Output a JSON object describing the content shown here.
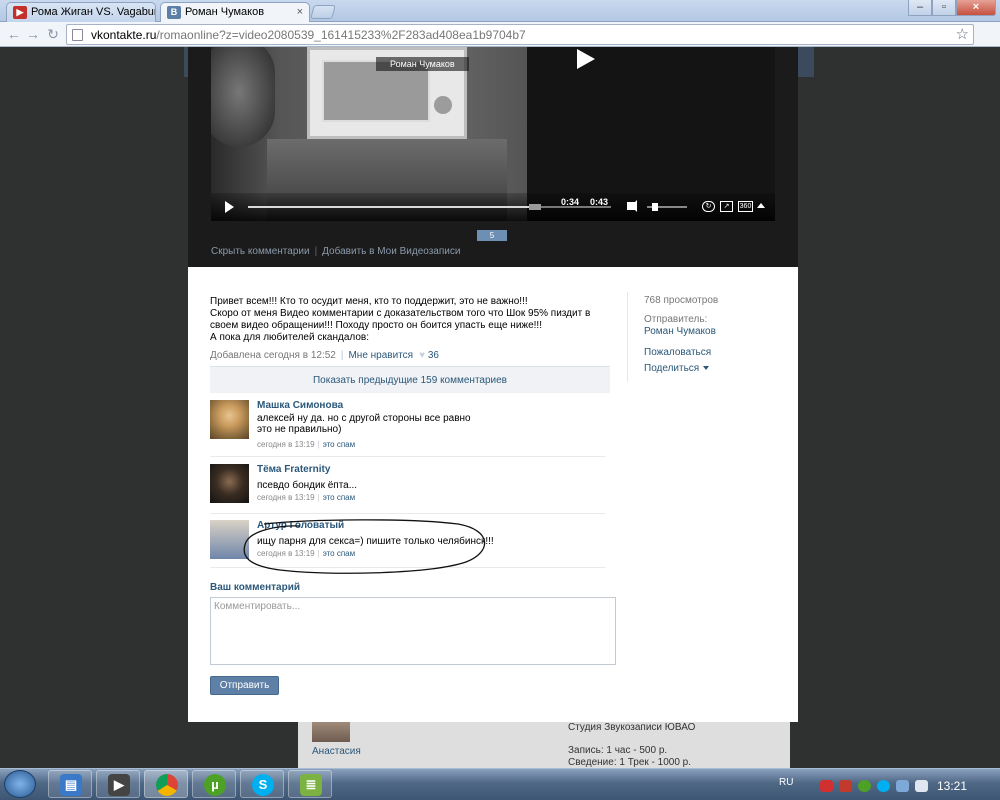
{
  "browser": {
    "tabs": [
      {
        "title": "Рома Жиган VS. Vagabund!",
        "favicon": "youtube-icon",
        "active": false
      },
      {
        "title": "Роман Чумаков",
        "favicon": "vk-icon",
        "active": true
      }
    ],
    "url_host": "vkontakte.ru",
    "url_path": "/romaonline?z=video2080539_161415233%2F283ad408ea1b9704b7"
  },
  "video": {
    "overlay_title": "Роман Чумаков",
    "current_time": "0:34",
    "duration": "0:43",
    "progress_fraction": 0.79,
    "quality_label": "360",
    "badge": "5",
    "hide_comments_link": "Скрыть комментарии",
    "add_to_videos_link": "Добавить в Мои Видеозаписи"
  },
  "description": {
    "lines": [
      "Привет всем!!! Кто то осудит меня, кто то поддержит, это не важно!!!",
      "Скоро от меня Видео комментарии с доказательством того что Шок 95% пиздит в своем видео обращении!!! Походу просто он боится упасть еще ниже!!!",
      "А пока для любителей скандалов:"
    ],
    "added": "Добавлена сегодня в 12:52",
    "like_label": "Мне нравится",
    "like_count": "36"
  },
  "sidebar": {
    "views": "768 просмотров",
    "sender_label": "Отправитель:",
    "sender_name": "Роман Чумаков",
    "report": "Пожаловаться",
    "share": "Поделиться"
  },
  "comments": {
    "show_previous": "Показать предыдущие 159 комментариев",
    "items": [
      {
        "author": "Машка Симонова",
        "text": "алексей ну да. но с другой стороны все равно это не правильно)",
        "time": "сегодня в 13:19",
        "spam": "это спам"
      },
      {
        "author": "Тёма Fraternity",
        "text": "псевдо бондик ёпта...",
        "time": "сегодня в 13:19",
        "spam": "это спам"
      },
      {
        "author": "Артур Головатый",
        "text": "ищу парня для секса=) пишите только челябинск!!!",
        "time": "сегодня в 13:19",
        "spam": "это спам"
      }
    ]
  },
  "your_comment": {
    "title": "Ваш комментарий",
    "placeholder": "Комментировать...",
    "send": "Отправить"
  },
  "background": {
    "friend_name": "Анастасия",
    "studio_lines": [
      "Студия Звукозаписи ЮВАО",
      "Запись: 1 час - 500 р.",
      "Сведение: 1 Трек - 1000 р."
    ]
  },
  "taskbar": {
    "apps": [
      "explorer-icon",
      "media-player-icon",
      "chrome-icon",
      "utorrent-icon",
      "skype-icon",
      "notepad-icon"
    ],
    "lang": "RU",
    "time": "13:21"
  },
  "colors": {
    "link": "#2b587a",
    "vk_button": "#5e80a6",
    "video_bg": "#1b1b1b"
  }
}
